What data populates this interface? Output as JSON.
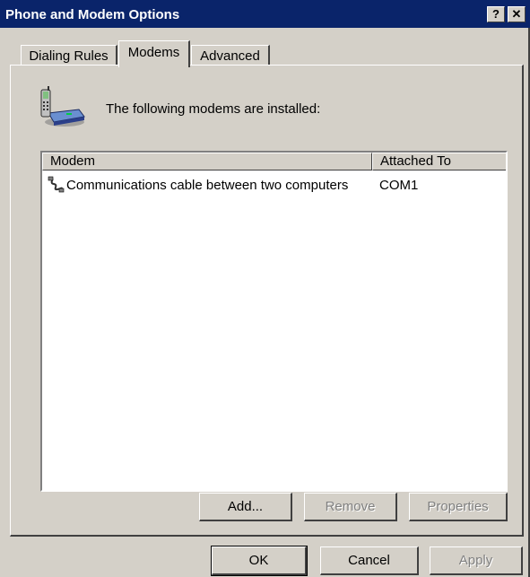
{
  "window": {
    "title": "Phone and Modem Options",
    "help_label": "?",
    "close_label": "✕"
  },
  "tabs": [
    {
      "label": "Dialing Rules",
      "active": false
    },
    {
      "label": "Modems",
      "active": true
    },
    {
      "label": "Advanced",
      "active": false
    }
  ],
  "modems_tab": {
    "header_text": "The following modems are  installed:",
    "header_icon": "phone-modem-icon",
    "list": {
      "columns": [
        "Modem",
        "Attached To"
      ],
      "rows": [
        {
          "icon": "cable-icon",
          "modem": "Communications cable between two computers",
          "attached_to": "COM1"
        }
      ]
    },
    "buttons": {
      "add": "Add...",
      "remove": "Remove",
      "properties": "Properties"
    }
  },
  "dialog_buttons": {
    "ok": "OK",
    "cancel": "Cancel",
    "apply": "Apply"
  },
  "colors": {
    "titlebar": "#0a246a",
    "face": "#d4d0c8",
    "disabled_text": "#808080"
  }
}
